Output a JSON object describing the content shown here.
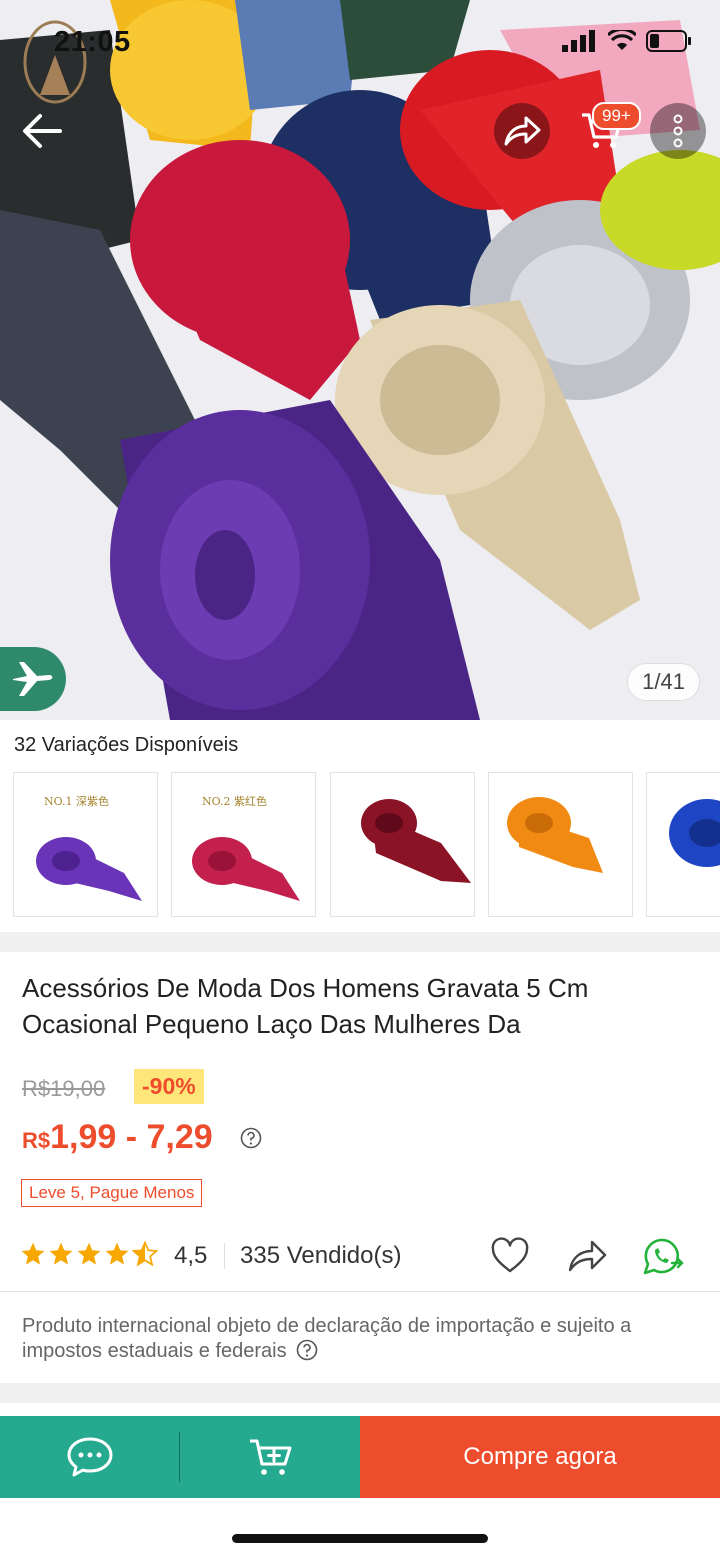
{
  "status_bar": {
    "time": "21:05"
  },
  "header": {
    "cart_badge": "99+"
  },
  "gallery": {
    "counter": "1/41"
  },
  "variations": {
    "title": "32 Variações Disponíveis",
    "thumbs": [
      {
        "label": "NO.1 深紫色",
        "color": "#6a34b8"
      },
      {
        "label": "NO.2 紫红色",
        "color": "#c4204e"
      },
      {
        "label": "",
        "color": "#8a1426"
      },
      {
        "label": "",
        "color": "#f08a12"
      },
      {
        "label": "",
        "color": "#1e45c4"
      }
    ]
  },
  "product": {
    "title": "Acessórios De Moda Dos Homens Gravata 5 Cm Ocasional Pequeno Laço Das Mulheres Da",
    "old_price": "R$19,00",
    "discount": "-90%",
    "price_currency": "R$",
    "price_range": "1,99 - 7,29",
    "promo": "Leve 5, Pague Menos",
    "rating": "4,5",
    "rating_value": 4.5,
    "sold": "335 Vendido(s)",
    "import_note": "Produto internacional objeto de declaração de importação e sujeito a impostos estaduais e federais"
  },
  "bottom_bar": {
    "buy_label": "Compre agora"
  },
  "colors": {
    "accent": "#ee4d2d",
    "teal": "#25a98f",
    "star": "#f6a700"
  }
}
